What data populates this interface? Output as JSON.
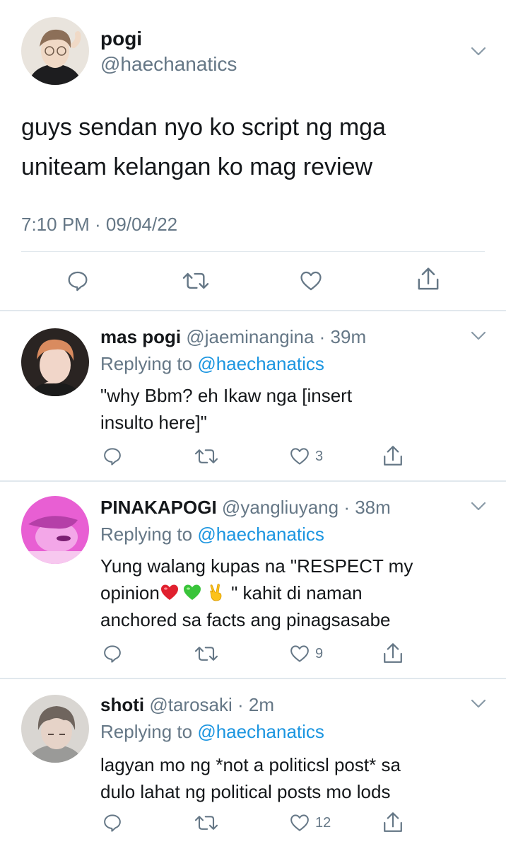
{
  "main_tweet": {
    "display_name": "pogi",
    "handle": "@haechanatics",
    "text_line1": "guys sendan nyo ko script ng mga",
    "text_line2": "uniteam kelangan ko mag review",
    "timestamp": "7:10 PM · 09/04/22",
    "icons": [
      "reply-icon",
      "retweet-icon",
      "like-icon",
      "share-icon",
      "chevron-down-icon"
    ]
  },
  "replies": [
    {
      "display_name": "mas pogi",
      "handle": "@jaeminangina",
      "time": "· 39m",
      "replying_prefix": "Replying to",
      "replying_handle": "@haechanatics",
      "text_line1": "\"why Bbm? eh Ikaw nga [insert",
      "text_line2": "insulto here]\"",
      "likes": "3"
    },
    {
      "display_name": "PINAKAPOGI",
      "handle": "@yangliuyang",
      "time": "· 38m",
      "replying_prefix": "Replying to",
      "replying_handle": "@haechanatics",
      "text_line1a": "Yung walang kupas na \"RESPECT my",
      "text_line2a": "opinion",
      "text_line2b": " \" kahit di naman",
      "text_line3": "anchored sa facts ang pinagsasabe",
      "emojis": [
        "red-heart-emoji",
        "green-heart-emoji",
        "victory-hand-emoji"
      ],
      "likes": "9"
    },
    {
      "display_name": "shoti",
      "handle": "@tarosaki",
      "time": "· 2m",
      "replying_prefix": "Replying to",
      "replying_handle": "@haechanatics",
      "text_line1": "lagyan mo ng *not a politicsl post* sa",
      "text_line2": "dulo lahat ng political posts mo lods",
      "likes": "12"
    }
  ],
  "colors": {
    "text": "#14171a",
    "muted": "#657786",
    "link": "#1b95e0",
    "divider": "#e1e8ed"
  }
}
